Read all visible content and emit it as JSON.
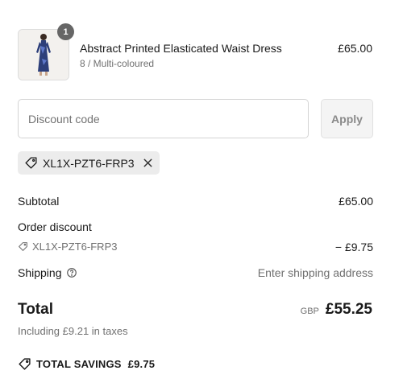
{
  "line_item": {
    "title": "Abstract Printed Elasticated Waist Dress",
    "variant": "8 / Multi-coloured",
    "price": "£65.00",
    "quantity": "1"
  },
  "discount": {
    "placeholder": "Discount code",
    "apply_label": "Apply",
    "applied_code": "XL1X-PZT6-FRP3"
  },
  "summary": {
    "subtotal_label": "Subtotal",
    "subtotal_value": "£65.00",
    "order_discount_label": "Order discount",
    "discount_code": "XL1X-PZT6-FRP3",
    "discount_value": "− £9.75",
    "shipping_label": "Shipping",
    "shipping_value": "Enter shipping address"
  },
  "total": {
    "label": "Total",
    "currency": "GBP",
    "amount": "£55.25",
    "taxes_note": "Including £9.21 in taxes"
  },
  "savings": {
    "label": "TOTAL SAVINGS",
    "amount": "£9.75"
  },
  "icons": [
    "tag-icon",
    "close-icon",
    "help-circle-icon"
  ]
}
